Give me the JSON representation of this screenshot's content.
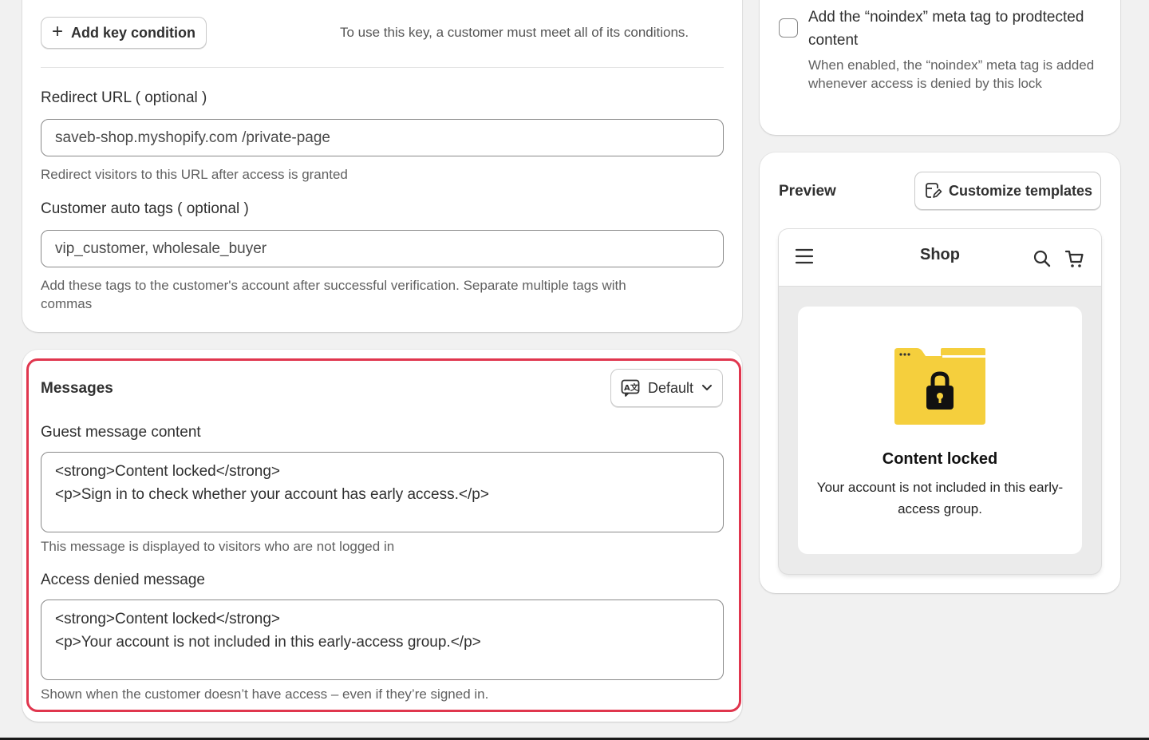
{
  "settings": {
    "add_key_label": "Add key condition",
    "add_key_hint": "To use this key, a customer must meet all of its conditions.",
    "redirect_label": "Redirect URL ( optional )",
    "redirect_value": "saveb-shop.myshopify.com  /private-page",
    "redirect_help": "Redirect visitors to this URL after access is granted",
    "tags_label": "Customer auto tags ( optional )",
    "tags_value": "vip_customer, wholesale_buyer",
    "tags_help_line1": "Add these tags to the customer's account after successful verification. Separate multiple tags with",
    "tags_help_line2": "commas"
  },
  "messages": {
    "title": "Messages",
    "language": "Default",
    "guest_label": "Guest message content",
    "guest_value": "<strong>Content locked</strong>\n<p>Sign in to check whether your account has early access.</p>",
    "guest_help": "This message is displayed to visitors who are not logged in",
    "denied_label": "Access denied message",
    "denied_value": "<strong>Content locked</strong>\n<p>Your account is not included in this early-access group.</p>",
    "denied_help": "Shown when the customer doesn’t have access – even if they’re signed in."
  },
  "seo": {
    "noindex_checked": false,
    "noindex_title": "Add the “noindex” meta tag to prodtected content",
    "noindex_desc": "When enabled, the “noindex” meta tag is added whenever access is denied by this lock"
  },
  "preview": {
    "title": "Preview",
    "customize_label": "Customize templates",
    "shop_name": "Shop",
    "locked_title": "Content locked",
    "locked_text": "Your account is not included in this early-access group."
  },
  "colors": {
    "highlight": "#e0364e",
    "folder": "#f5cf3d",
    "background": "#f1f1f1"
  }
}
